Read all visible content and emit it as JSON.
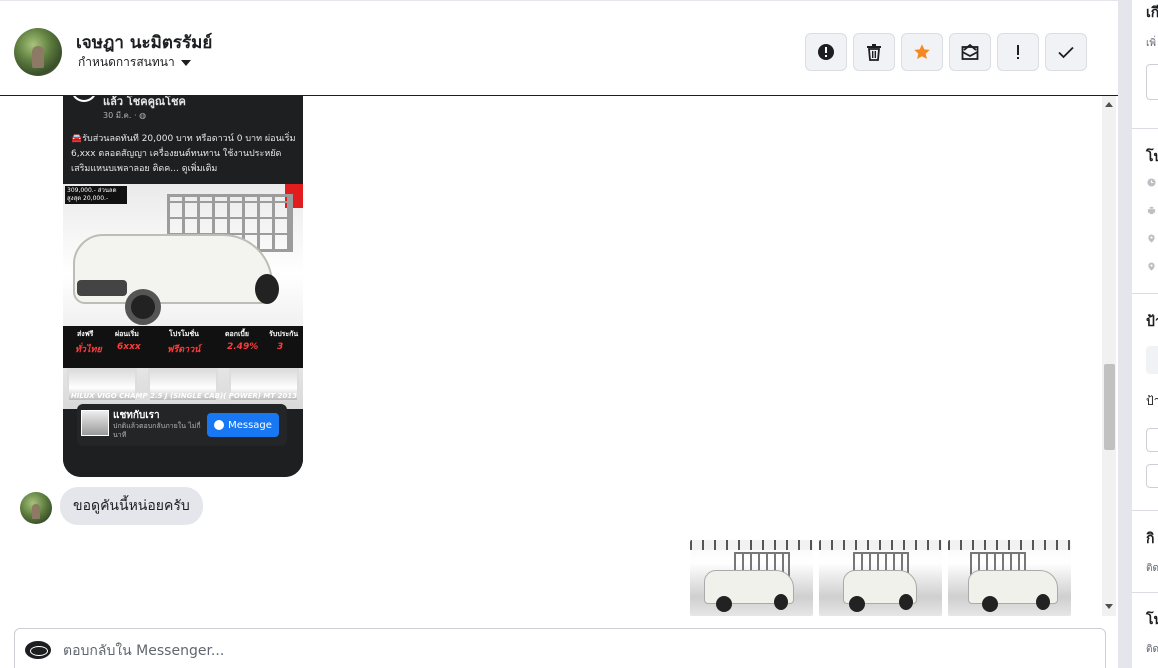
{
  "header": {
    "contact_name": "เจษฎา นะมิตรรัมย์",
    "conversation_settings": "กำหนดการสนทนา",
    "actions": [
      {
        "name": "mark-spam",
        "icon": "exclamation-circle-icon"
      },
      {
        "name": "delete",
        "icon": "trash-icon"
      },
      {
        "name": "star",
        "icon": "star-icon"
      },
      {
        "name": "mark-unread",
        "icon": "envelope-icon"
      },
      {
        "name": "follow-up",
        "icon": "exclamation-icon"
      },
      {
        "name": "mark-done",
        "icon": "checkmark-icon"
      }
    ],
    "colors": {
      "star": "#f5891f",
      "icon": "#1c1e21",
      "button_bg": "#f0f2f5"
    }
  },
  "shared_post": {
    "page_name": "แล้ว โชคคูณโชค",
    "date": "30 มี.ค. ·",
    "body": "🚘รับส่วนลดทันที 20,000 บาท หรือดาวน์ 0 บาท ผ่อนเริ่ม 6,xxx ตลอดสัญญา เครื่องยนต์ทนทาน ใช้งานประหยัด เสริมแหนบเพลาลอย ติดค... ดูเพิ่มเติม",
    "ad_badge": "309,000.- ส่วนลดสูงสุด 20,000.-",
    "promos": [
      {
        "label": "ส่งฟรี",
        "value": "ทั่วไทย"
      },
      {
        "label": "ผ่อนเริ่ม",
        "value": "6xxx"
      },
      {
        "label": "โปรโมชั่น",
        "value": "ฟรีดาวน์"
      },
      {
        "label": "ดอกเบี้ย",
        "value": "2.49%"
      },
      {
        "label": "รับประกัน",
        "value": "3"
      }
    ],
    "model": "HILUX VIGO CHAMP 2.5 J (SINGLE CAB)( POWER) MT 2013",
    "messenger_card": {
      "title": "แชทกับเรา",
      "subtitle": "ปกติแล้วตอบกลับภายใน ไม่กี่นาที",
      "button": "Message"
    }
  },
  "messages": [
    {
      "direction": "incoming",
      "text": "ขอดูคันนี้หน่อยครับ"
    }
  ],
  "outgoing_photos_count": 3,
  "composer": {
    "placeholder": "ตอบกลับใน Messenger..."
  },
  "right_panel": {
    "section1_title": "เกี",
    "section1_sub": "เพิ่",
    "section2_title": "โป",
    "section3_title": "ป้า",
    "section3_sub": "ป้า",
    "section4_title": "กิ",
    "section4_sub": "ติด",
    "section5_title": "โน",
    "section5_sub": "ติด"
  }
}
